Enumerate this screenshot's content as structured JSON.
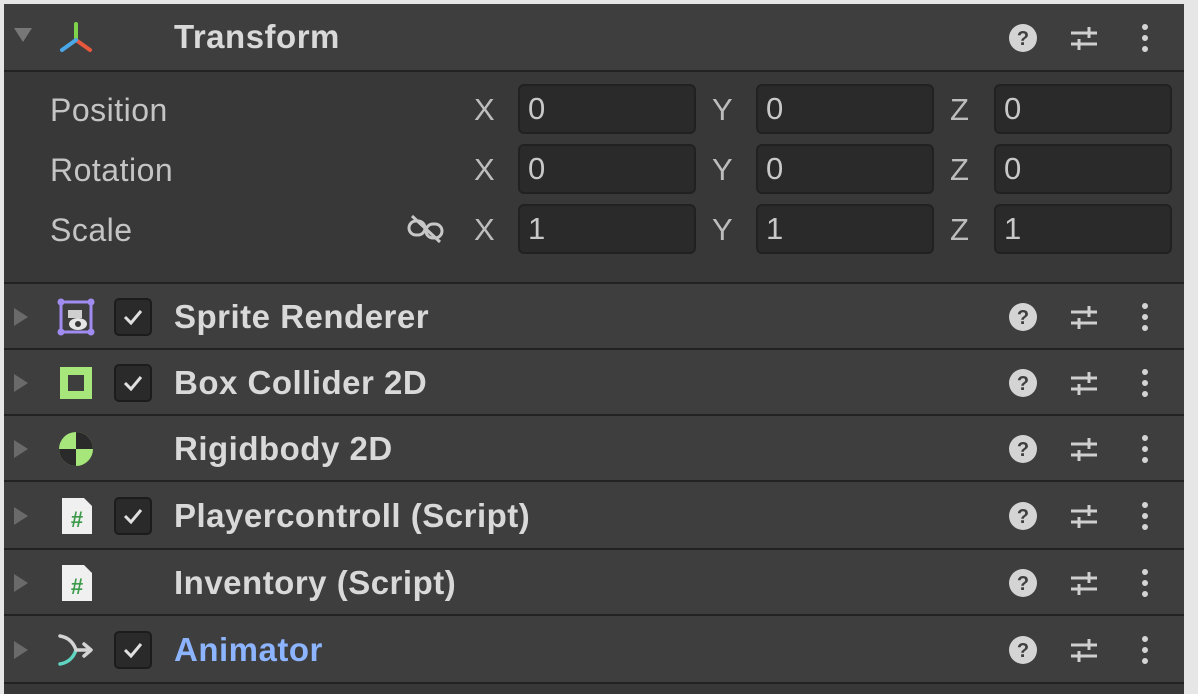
{
  "transform": {
    "title": "Transform",
    "icon": "transform-axes-icon",
    "rows": [
      {
        "label": "Position",
        "x": "0",
        "y": "0",
        "z": "0"
      },
      {
        "label": "Rotation",
        "x": "0",
        "y": "0",
        "z": "0"
      },
      {
        "label": "Scale",
        "x": "1",
        "y": "1",
        "z": "1"
      }
    ],
    "axes": {
      "x": "X",
      "y": "Y",
      "z": "Z"
    }
  },
  "components": [
    {
      "title": "Sprite Renderer",
      "icon": "sprite-renderer-icon",
      "has_checkbox": true,
      "checked": true
    },
    {
      "title": "Box Collider 2D",
      "icon": "box-collider-icon",
      "has_checkbox": true,
      "checked": true
    },
    {
      "title": "Rigidbody 2D",
      "icon": "rigidbody-icon",
      "has_checkbox": false
    },
    {
      "title": "Playercontroll (Script)",
      "icon": "script-icon",
      "has_checkbox": true,
      "checked": true
    },
    {
      "title": "Inventory (Script)",
      "icon": "script-icon",
      "has_checkbox": false
    },
    {
      "title": "Animator",
      "icon": "animator-icon",
      "has_checkbox": true,
      "checked": true,
      "highlight": true
    }
  ],
  "colors": {
    "panel_bg": "#383838",
    "header_bg": "#3e3e3e",
    "field_bg": "#2a2a2a",
    "text": "#d9d9d9",
    "animator_title": "#8cb4ff",
    "collider_green": "#a6e67a",
    "sprite_purple": "#a08cf0"
  }
}
